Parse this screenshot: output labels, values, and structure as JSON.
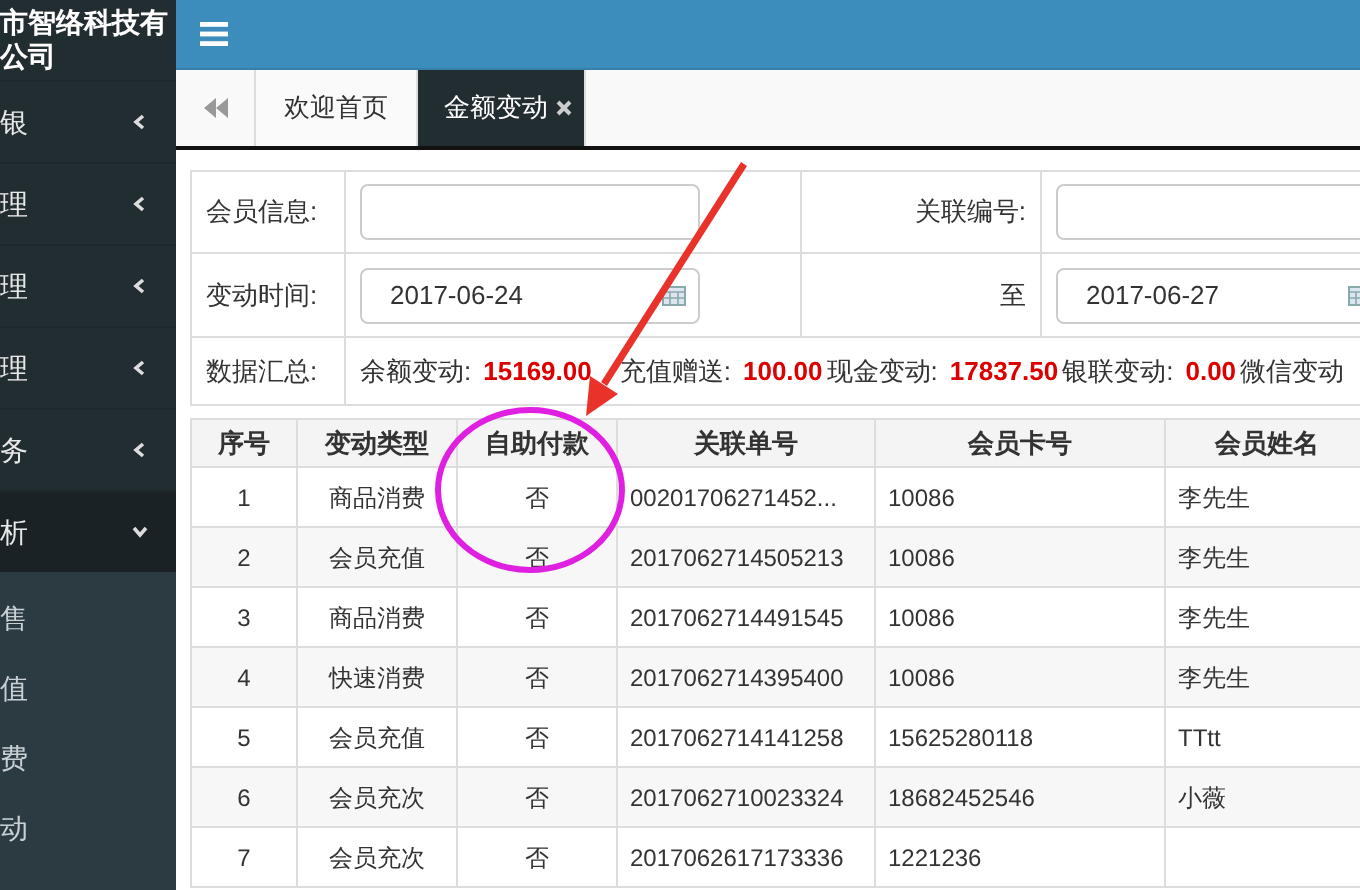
{
  "sidebar": {
    "brand": [
      "市智络科技有",
      "公司"
    ],
    "items": [
      {
        "label": "银",
        "expanded": false
      },
      {
        "label": "理",
        "expanded": false
      },
      {
        "label": "理",
        "expanded": false
      },
      {
        "label": "理",
        "expanded": false
      },
      {
        "label": "务",
        "expanded": false
      },
      {
        "label": "析",
        "expanded": true,
        "children": [
          {
            "label": "售"
          },
          {
            "label": "值"
          },
          {
            "label": "费"
          },
          {
            "label": "动"
          }
        ]
      }
    ]
  },
  "tabs": [
    {
      "label": "欢迎首页",
      "selected": false,
      "closable": false
    },
    {
      "label": "金额变动",
      "selected": true,
      "closable": true
    }
  ],
  "filters": [
    {
      "label": "会员信息:",
      "kind": "text"
    },
    {
      "label": "关联编号:",
      "kind": "text"
    },
    {
      "label": "变动时间:",
      "kind": "date",
      "value": "2017-06-24"
    },
    {
      "label": "至",
      "kind": "date",
      "value": "2017-06-27"
    }
  ],
  "summary": {
    "label": "数据汇总:",
    "items": [
      {
        "label": "余额变动:",
        "value": "15169.00"
      },
      {
        "label": "充值赠送:",
        "value": "100.00"
      },
      {
        "label": "现金变动:",
        "value": "17837.50"
      },
      {
        "label": "银联变动:",
        "value": "0.00"
      },
      {
        "label": "微信变动"
      }
    ]
  },
  "table": {
    "columns": [
      "序号",
      "变动类型",
      "自助付款",
      "关联单号",
      "会员卡号",
      "会员姓名"
    ],
    "rows": [
      [
        "1",
        "商品消费",
        "否",
        "00201706271452...",
        "10086",
        "李先生"
      ],
      [
        "2",
        "会员充值",
        "否",
        "2017062714505213",
        "10086",
        "李先生"
      ],
      [
        "3",
        "商品消费",
        "否",
        "2017062714491545",
        "10086",
        "李先生"
      ],
      [
        "4",
        "快速消费",
        "否",
        "2017062714395400",
        "10086",
        "李先生"
      ],
      [
        "5",
        "会员充值",
        "否",
        "2017062714141258",
        "15625280118",
        "TTtt"
      ],
      [
        "6",
        "会员充次",
        "否",
        "2017062710023324",
        "18682452546",
        "小薇"
      ],
      [
        "7",
        "会员充次",
        "否",
        "2017062617173336",
        "1221236"
      ]
    ]
  }
}
